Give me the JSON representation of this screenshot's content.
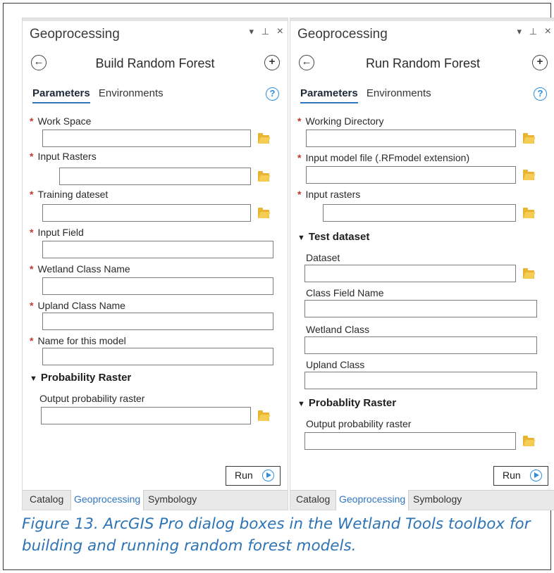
{
  "left_pane": {
    "title": "Geoprocessing",
    "ctrl_pin": "▾",
    "ctrl_dock": "⊥",
    "ctrl_close": "×",
    "back_icon": "back-arrow-icon",
    "tool_title": "Build Random Forest",
    "add_icon": "plus-icon",
    "tab_parameters": "Parameters",
    "tab_environments": "Environments",
    "help": "?",
    "params": [
      {
        "label": "Work Space",
        "required": true
      },
      {
        "label": "Input Rasters",
        "required": true
      },
      {
        "label": "Training dateset",
        "required": true
      },
      {
        "label": "Input Field",
        "required": true
      },
      {
        "label": "Wetland Class Name",
        "required": true
      },
      {
        "label": "Upland Class Name",
        "required": true
      },
      {
        "label": "Name for this model",
        "required": true
      }
    ],
    "section": "Probability Raster",
    "section_param": "Output probability raster",
    "run_label": "Run",
    "bottom_tabs": [
      "Catalog",
      "Geoprocessing",
      "Symbology"
    ],
    "active_bottom_tab": "Geoprocessing"
  },
  "right_pane": {
    "title": "Geoprocessing",
    "ctrl_pin": "▾",
    "ctrl_dock": "⊥",
    "ctrl_close": "×",
    "back_icon": "back-arrow-icon",
    "tool_title": "Run Random Forest",
    "add_icon": "plus-icon",
    "tab_parameters": "Parameters",
    "tab_environments": "Environments",
    "help": "?",
    "params": [
      {
        "label": "Working Directory",
        "required": true
      },
      {
        "label": "Input model file (.RFmodel extension)",
        "required": true
      },
      {
        "label": "Input rasters",
        "required": true
      }
    ],
    "section1": "Test dataset",
    "section1_params": [
      "Dataset",
      "Class Field Name",
      "Wetland Class",
      "Upland Class"
    ],
    "section2": "Probablity Raster",
    "section2_param": "Output probability raster",
    "run_label": "Run",
    "bottom_tabs": [
      "Catalog",
      "Geoprocessing",
      "Symbology"
    ],
    "active_bottom_tab": "Geoprocessing"
  },
  "caption": "Figure 13. ArcGIS Pro dialog boxes in the Wetland Tools toolbox for building and running random forest models.",
  "colors": {
    "accent": "#2f76c0",
    "required": "#c0392b",
    "caption": "#2e74b5",
    "folder": "#e8b432"
  }
}
